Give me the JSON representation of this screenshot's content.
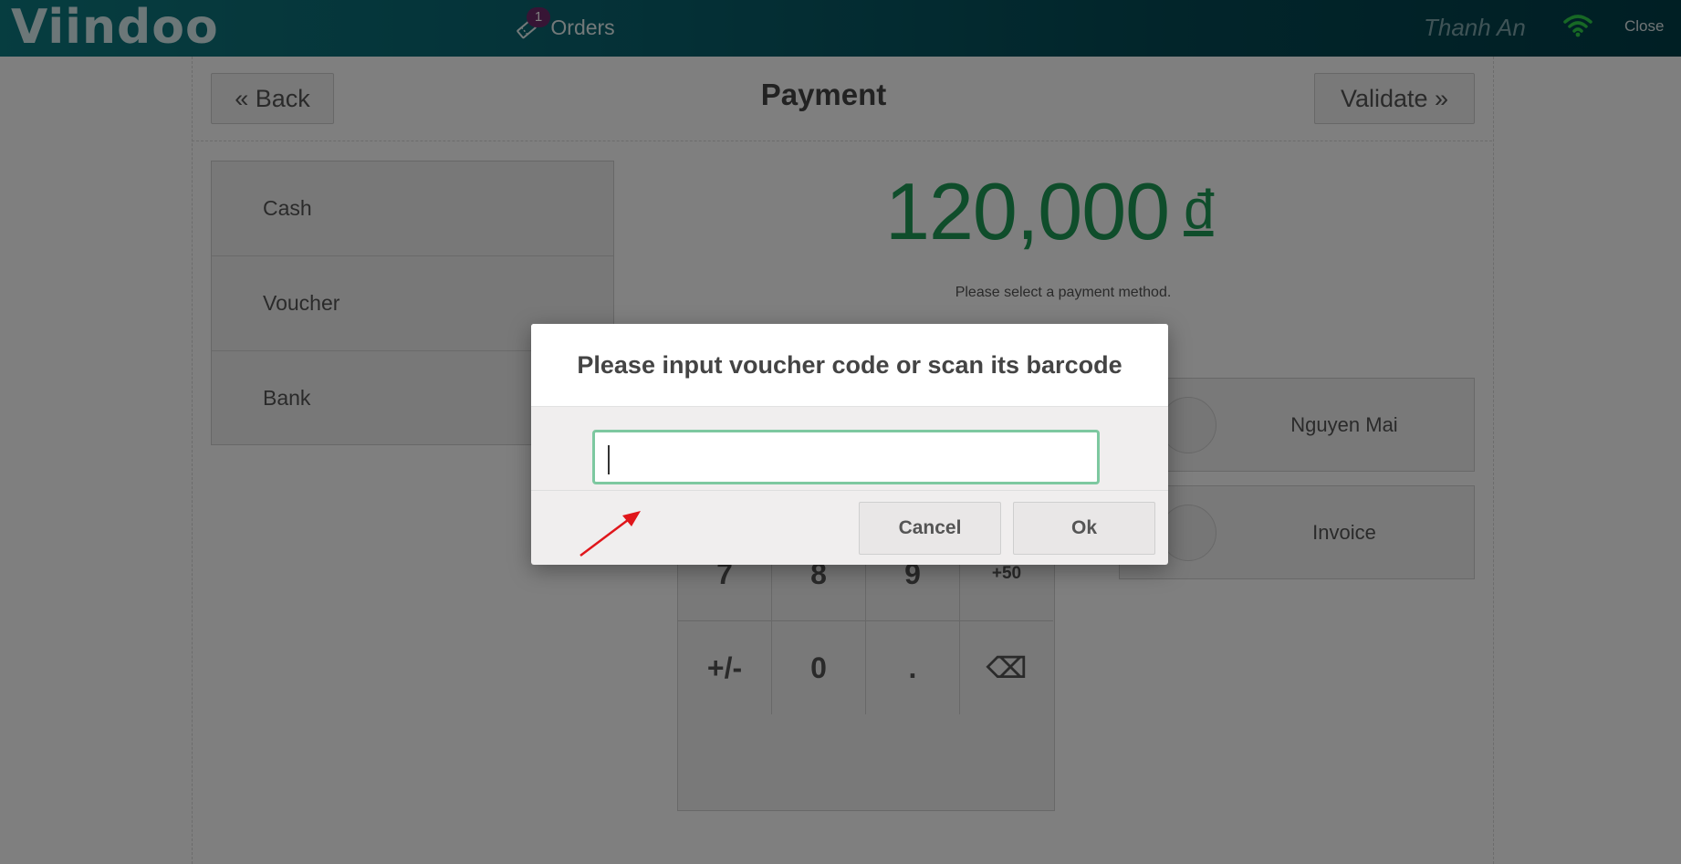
{
  "topbar": {
    "logo": "Viindoo",
    "orders_label": "Orders",
    "orders_badge": "1",
    "cashier": "Thanh An",
    "close_label": "Close"
  },
  "payment": {
    "back_label": "« Back",
    "title": "Payment",
    "validate_label": "Validate »",
    "amount": "120,000",
    "currency": "đ",
    "hint": "Please select a payment method.",
    "methods": [
      "Cash",
      "Voucher",
      "Bank"
    ],
    "customer_label": "Nguyen Mai",
    "invoice_label": "Invoice",
    "numpad": {
      "row3": [
        "7",
        "8",
        "9",
        "+50"
      ],
      "row4": [
        "+/-",
        "0",
        ".",
        "⌫"
      ]
    }
  },
  "modal": {
    "title": "Please input voucher code or scan its barcode",
    "input_value": "",
    "cancel_label": "Cancel",
    "ok_label": "Ok"
  },
  "colors": {
    "topbar": "#044a55",
    "amount": "#1f9a56",
    "input_border": "#7dc8a0",
    "annotation_arrow": "#e0161b"
  }
}
